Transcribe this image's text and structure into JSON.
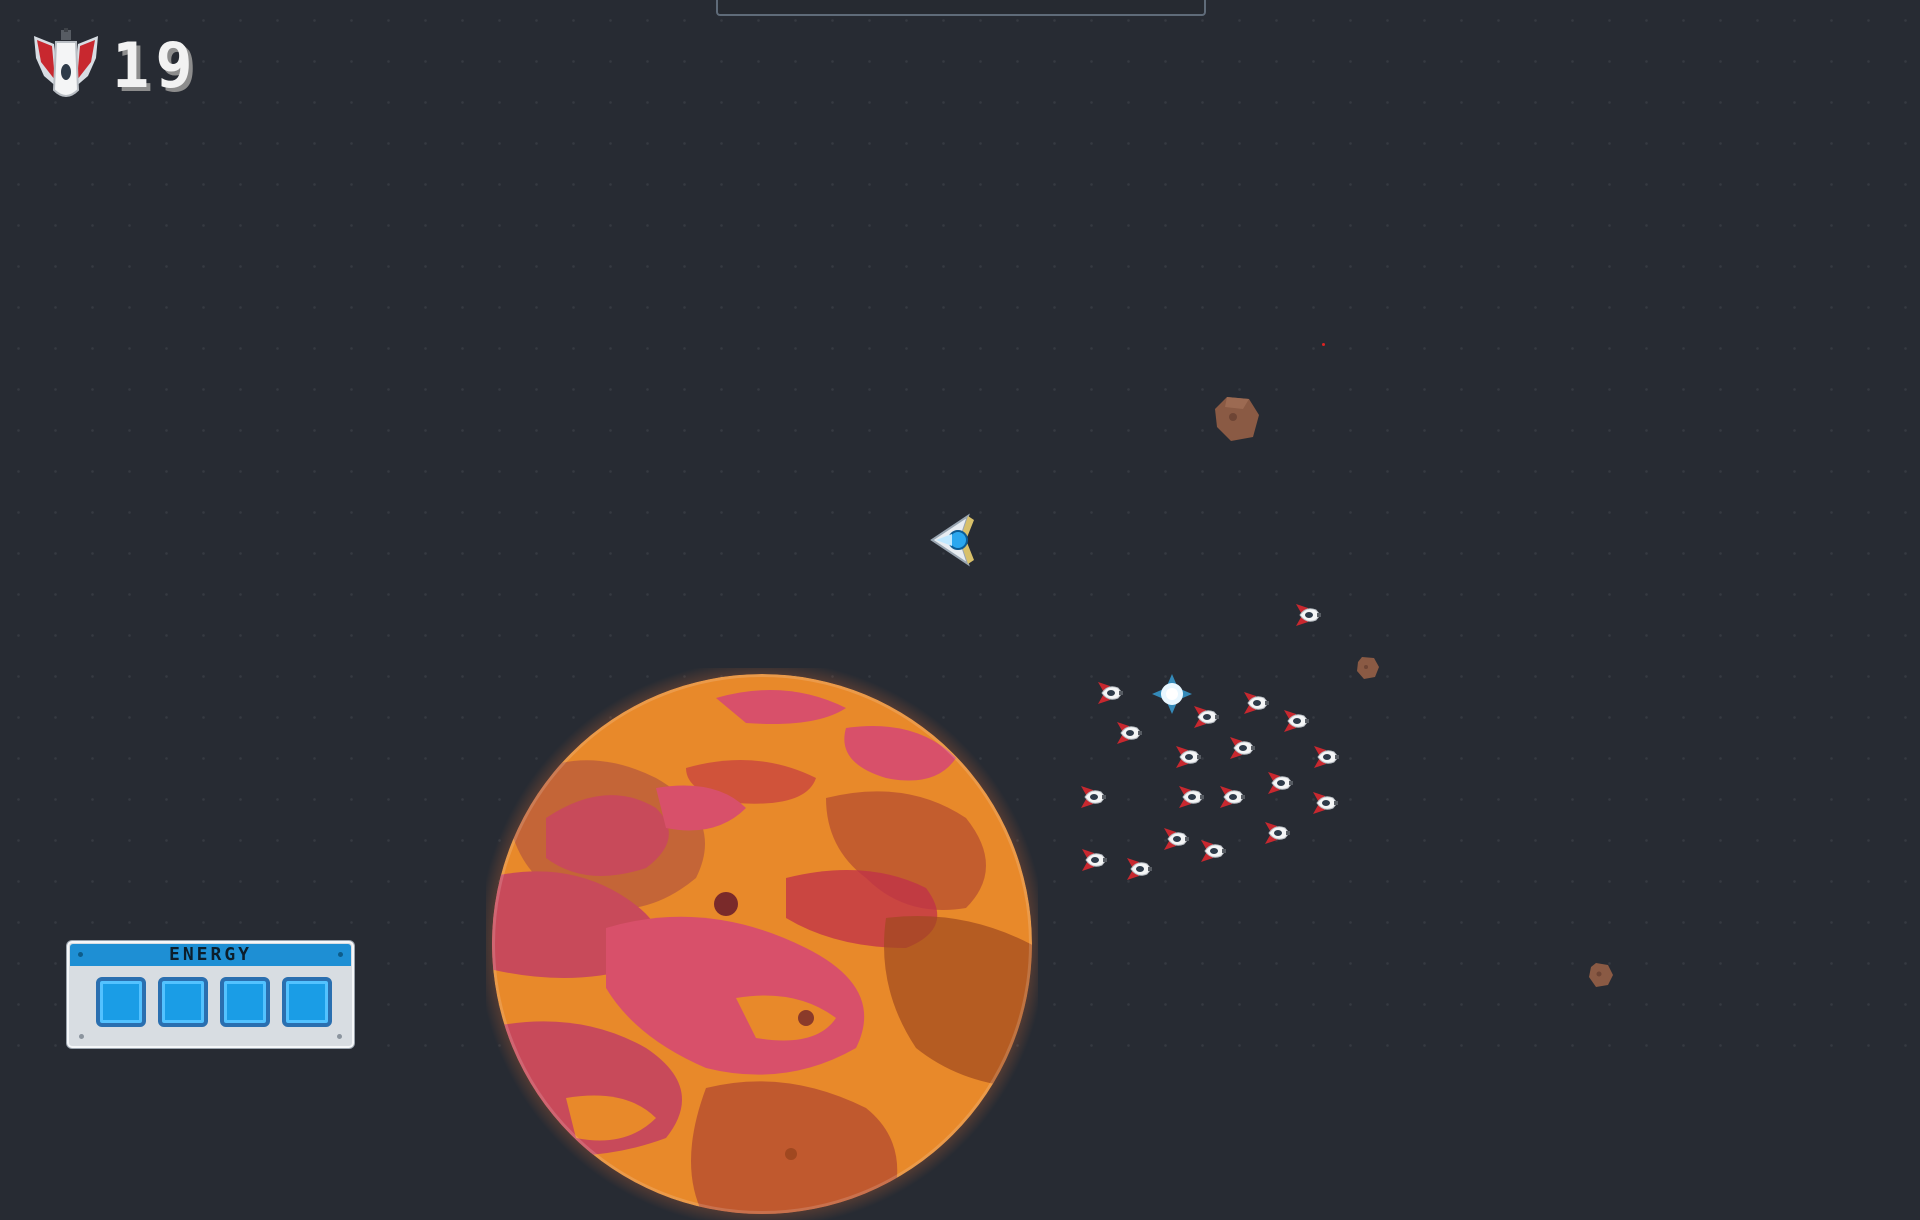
{
  "hud": {
    "lives": "19",
    "lives_icon": "ship-lives-icon",
    "energy_label": "ENERGY",
    "energy_cells": 4,
    "energy_cells_filled": 4
  },
  "colors": {
    "background": "#272b33",
    "energy_blue": "#1a9de6",
    "enemy_red": "#c8282f",
    "planet_orange": "#e8892a",
    "planet_pink": "#c84a5a",
    "asteroid": "#8a5a44"
  },
  "sprites": {
    "player": "player-ship",
    "enemy": "enemy-ship",
    "asteroid": "asteroid",
    "powerup": "energy-powerup",
    "planet": "planet"
  }
}
